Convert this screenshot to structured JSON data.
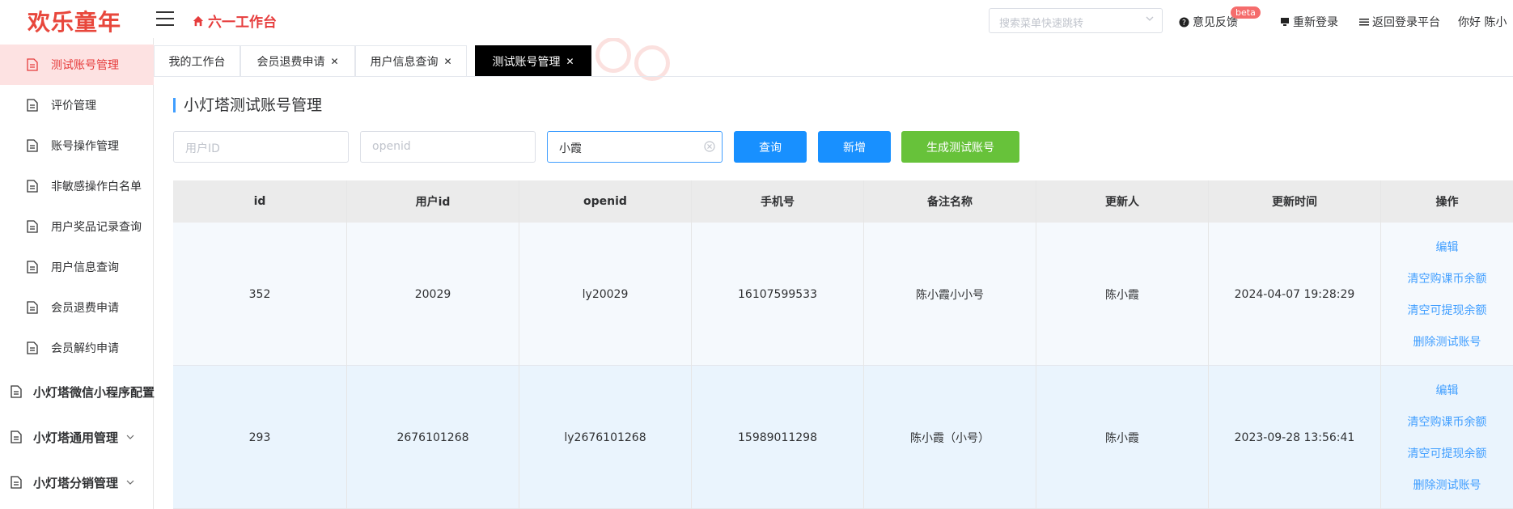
{
  "header": {
    "logo": "欢乐童年",
    "workbench": "六一工作台",
    "menu_search_placeholder": "搜索菜单快速跳转",
    "feedback": "意见反馈",
    "beta": "beta",
    "relogin": "重新登录",
    "back_platform": "返回登录平台",
    "greeting": "你好 陈小"
  },
  "sidebar": {
    "items": [
      {
        "label": "测试账号管理",
        "active": true
      },
      {
        "label": "评价管理"
      },
      {
        "label": "账号操作管理"
      },
      {
        "label": "非敏感操作白名单"
      },
      {
        "label": "用户奖品记录查询"
      },
      {
        "label": "用户信息查询"
      },
      {
        "label": "会员退费申请"
      },
      {
        "label": "会员解约申请"
      }
    ],
    "groups": [
      {
        "label": "小灯塔微信小程序配置"
      },
      {
        "label": "小灯塔通用管理"
      },
      {
        "label": "小灯塔分销管理"
      }
    ]
  },
  "tabs": [
    {
      "label": "我的工作台"
    },
    {
      "label": "会员退费申请"
    },
    {
      "label": "用户信息查询"
    },
    {
      "label": "测试账号管理",
      "active": true
    }
  ],
  "page": {
    "title": "小灯塔测试账号管理",
    "filters": {
      "user_id_placeholder": "用户ID",
      "openid_placeholder": "openid",
      "name_value": "小霞"
    },
    "buttons": {
      "query": "查询",
      "add": "新增",
      "generate": "生成测试账号"
    }
  },
  "table": {
    "headers": [
      "id",
      "用户id",
      "openid",
      "手机号",
      "备注名称",
      "更新人",
      "更新时间",
      "操作"
    ],
    "rows": [
      {
        "id": "352",
        "user_id": "20029",
        "openid": "ly20029",
        "phone": "16107599533",
        "remark": "陈小霞小小号",
        "updater": "陈小霞",
        "updated_at": "2024-04-07 19:28:29"
      },
      {
        "id": "293",
        "user_id": "2676101268",
        "openid": "ly2676101268",
        "phone": "15989011298",
        "remark": "陈小霞（小号）",
        "updater": "陈小霞",
        "updated_at": "2023-09-28 13:56:41"
      }
    ],
    "actions": [
      "编辑",
      "清空购课币余额",
      "清空可提现余额",
      "删除测试账号"
    ]
  },
  "colors": {
    "brand_red": "#e63c3c",
    "primary_blue": "#1890ff",
    "green": "#67c23a",
    "link": "#409eff"
  }
}
